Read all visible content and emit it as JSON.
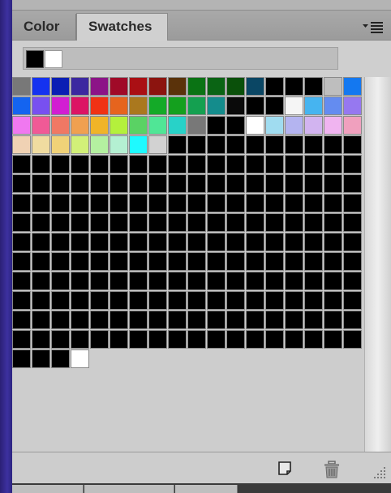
{
  "tabs": [
    {
      "label": "Color",
      "active": false
    },
    {
      "label": "Swatches",
      "active": true
    }
  ],
  "panel_menu_icon": "panel-menu-icon",
  "foreground_color": "#000000",
  "background_color": "#ffffff",
  "swatches": [
    "#787878",
    "#1432f0",
    "#0a1eb4",
    "#3c28a0",
    "#8c1487",
    "#a00a28",
    "#aa0f14",
    "#8c140f",
    "#5a320a",
    "#0a7314",
    "#0a6414",
    "#0a500a",
    "#0a4664",
    "#000000",
    "#000000",
    "#000000",
    "#bebebe",
    "#1478f0",
    "#1464f0",
    "#7850f0",
    "#d21ed2",
    "#dc1464",
    "#f03214",
    "#e6641e",
    "#aa781e",
    "#14aa28",
    "#14a01e",
    "#14a050",
    "#148c8c",
    "#0a0a0a",
    "#000000",
    "#000000",
    "#f5f5f5",
    "#46b4f0",
    "#648cf0",
    "#9678f0",
    "#f078f0",
    "#f05a96",
    "#f07864",
    "#f0a050",
    "#f0b428",
    "#b4f03c",
    "#5ad264",
    "#50e696",
    "#28d2c8",
    "#787878",
    "#000000",
    "#000000",
    "#ffffff",
    "#a0dcf0",
    "#b4b4f0",
    "#d2b4f0",
    "#f0b4f0",
    "#f0a0be",
    "#f0d2b4",
    "#f0dca0",
    "#f0d278",
    "#d2f078",
    "#b4f0a0",
    "#b4f0d2",
    "#1efaff",
    "#d2d2d2",
    "#000000",
    "#000000",
    "#000000",
    "#000000",
    "#000000",
    "#000000",
    "#000000",
    "#000000",
    "#000000",
    "#000000",
    "#000000",
    "#000000",
    "#000000",
    "#000000",
    "#000000",
    "#000000",
    "#000000",
    "#000000",
    "#000000",
    "#000000",
    "#000000",
    "#000000",
    "#000000",
    "#000000",
    "#000000",
    "#000000",
    "#000000",
    "#000000",
    "#000000",
    "#000000",
    "#000000",
    "#000000",
    "#000000",
    "#000000",
    "#000000",
    "#000000",
    "#000000",
    "#000000",
    "#000000",
    "#000000",
    "#000000",
    "#000000",
    "#000000",
    "#000000",
    "#000000",
    "#000000",
    "#000000",
    "#000000",
    "#000000",
    "#000000",
    "#000000",
    "#000000",
    "#000000",
    "#000000",
    "#000000",
    "#000000",
    "#000000",
    "#000000",
    "#000000",
    "#000000",
    "#000000",
    "#000000",
    "#000000",
    "#000000",
    "#000000",
    "#000000",
    "#000000",
    "#000000",
    "#000000",
    "#000000",
    "#000000",
    "#000000",
    "#000000",
    "#000000",
    "#000000",
    "#000000",
    "#000000",
    "#000000",
    "#000000",
    "#000000",
    "#000000",
    "#000000",
    "#000000",
    "#000000",
    "#000000",
    "#000000",
    "#000000",
    "#000000",
    "#000000",
    "#000000",
    "#000000",
    "#000000",
    "#000000",
    "#000000",
    "#000000",
    "#000000",
    "#000000",
    "#000000",
    "#000000",
    "#000000",
    "#000000",
    "#000000",
    "#000000",
    "#000000",
    "#000000",
    "#000000",
    "#000000",
    "#000000",
    "#000000",
    "#000000",
    "#000000",
    "#000000",
    "#000000",
    "#000000",
    "#000000",
    "#000000",
    "#000000",
    "#000000",
    "#000000",
    "#000000",
    "#000000",
    "#000000",
    "#000000",
    "#000000",
    "#000000",
    "#000000",
    "#000000",
    "#000000",
    "#000000",
    "#000000",
    "#000000",
    "#000000",
    "#000000",
    "#000000",
    "#000000",
    "#000000",
    "#000000",
    "#000000",
    "#000000",
    "#000000",
    "#000000",
    "#000000",
    "#000000",
    "#000000",
    "#000000",
    "#000000",
    "#000000",
    "#000000",
    "#000000",
    "#000000",
    "#000000",
    "#000000",
    "#000000",
    "#000000",
    "#000000",
    "#000000",
    "#000000",
    "#000000",
    "#000000",
    "#000000",
    "#000000",
    "#000000",
    "#000000",
    "#000000",
    "#000000",
    "#000000",
    "#000000",
    "#000000",
    "#000000",
    "#000000",
    "#000000",
    "#000000",
    "#000000",
    "#000000",
    "#000000",
    "#000000",
    "#000000",
    "#000000",
    "#000000",
    "#000000",
    "#000000",
    "#000000",
    "#000000",
    "#000000",
    "#000000",
    "#000000",
    "#000000",
    "#000000",
    "#000000",
    "#000000",
    "#000000",
    "#000000",
    "#000000",
    "#ffffff"
  ],
  "footer": {
    "new_swatch_icon": "new-swatch-icon",
    "delete_swatch_icon": "trash-icon",
    "resize_grip_icon": "resize-grip-icon"
  }
}
